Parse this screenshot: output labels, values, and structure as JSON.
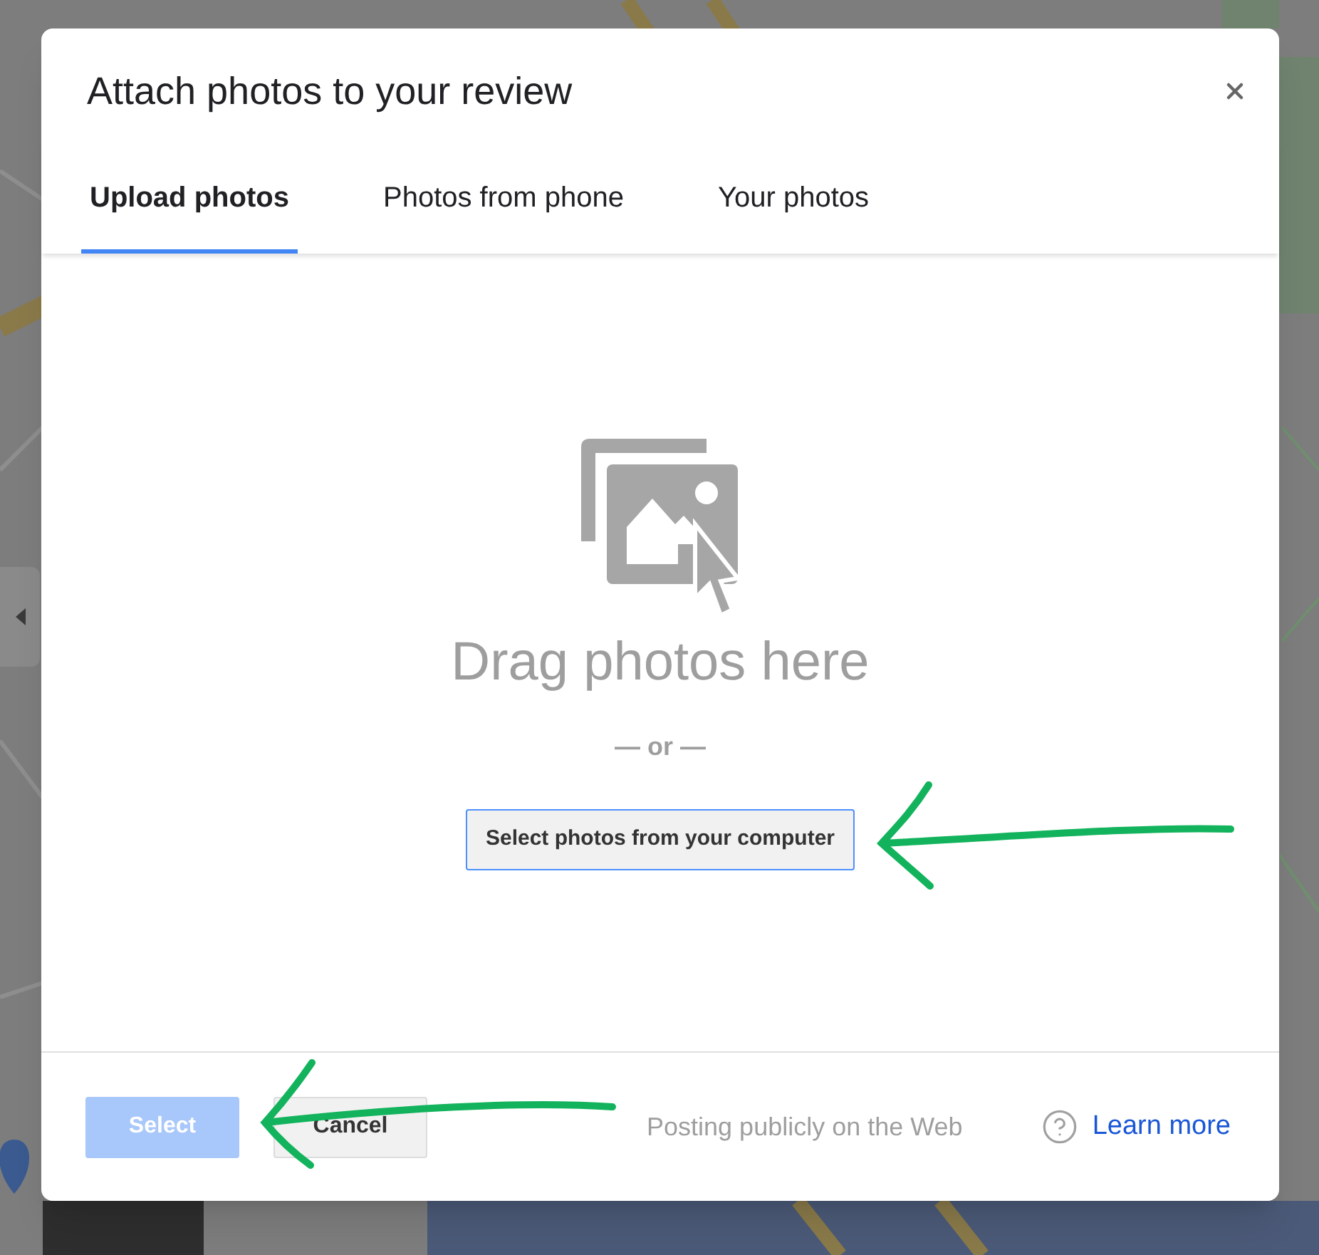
{
  "dialog": {
    "title": "Attach photos to your review",
    "tabs": [
      {
        "label": "Upload photos",
        "selected": true
      },
      {
        "label": "Photos from phone",
        "selected": false
      },
      {
        "label": "Your photos",
        "selected": false
      }
    ],
    "dropzone": {
      "heading": "Drag photos here",
      "separator": "— or —",
      "button": "Select photos from your computer"
    },
    "footer": {
      "buttons": [
        {
          "label": "Select",
          "kind": "primary",
          "disabled": true
        },
        {
          "label": "Cancel",
          "kind": "secondary",
          "disabled": false
        }
      ],
      "notice": "Posting publicly on the Web",
      "help_link": "Learn more"
    }
  }
}
